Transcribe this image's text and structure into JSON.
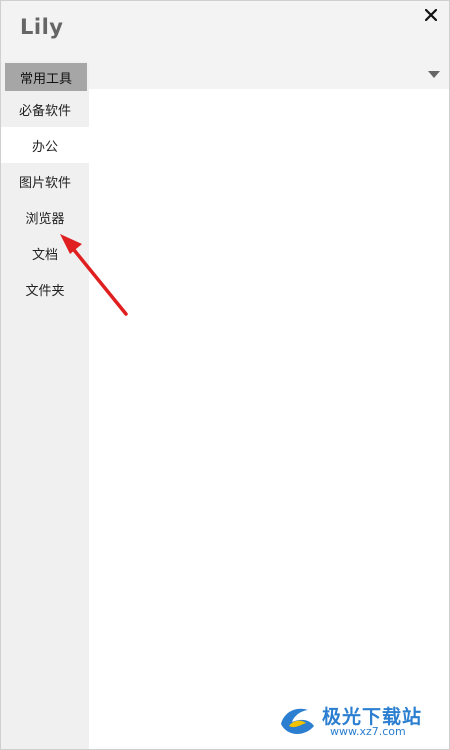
{
  "app": {
    "title": "Lily",
    "close_icon": "close-icon"
  },
  "toolbar": {
    "dropdown_icon": "caret-down-icon"
  },
  "sidebar": {
    "items": [
      {
        "label": "常用工具",
        "state": "header"
      },
      {
        "label": "必备软件",
        "state": "normal"
      },
      {
        "label": "办公",
        "state": "selected"
      },
      {
        "label": "图片软件",
        "state": "normal"
      },
      {
        "label": "浏览器",
        "state": "normal"
      },
      {
        "label": "文档",
        "state": "normal"
      },
      {
        "label": "文件夹",
        "state": "normal"
      }
    ]
  },
  "annotation": {
    "color": "#e02020",
    "icon": "red-arrow"
  },
  "watermark": {
    "text": "极光下载站",
    "url": "www.xz7.com"
  }
}
